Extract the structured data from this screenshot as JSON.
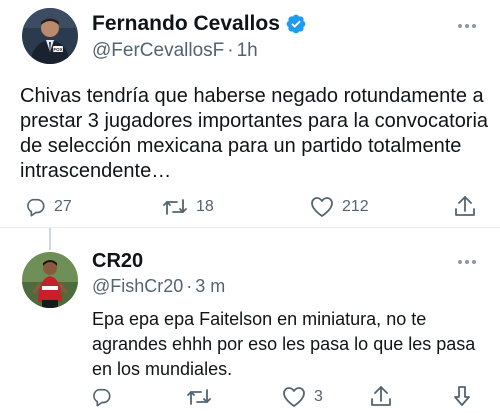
{
  "tweet": {
    "author_name": "Fernando Cevallos",
    "handle": "@FerCevallosF",
    "separator": "·",
    "time": "1h",
    "text": "Chivas tendría que haberse negado rotundamente a prestar 3 jugadores importantes para la convocatoria de selección mexicana para un partido totalmente intrascendente…",
    "replies": "27",
    "retweets": "18",
    "likes": "212",
    "verified": true
  },
  "reply": {
    "author_name": "CR20",
    "handle": "@FishCr20",
    "separator": "·",
    "time": "3 m",
    "text": "Epa epa epa Faitelson en miniatura, no te agrandes ehhh por eso les pasa lo que les pasa en los mundiales.",
    "likes": "3"
  },
  "colors": {
    "verified_badge": "#1d9bf0",
    "text_primary": "#0f1419",
    "text_secondary": "#536471"
  }
}
